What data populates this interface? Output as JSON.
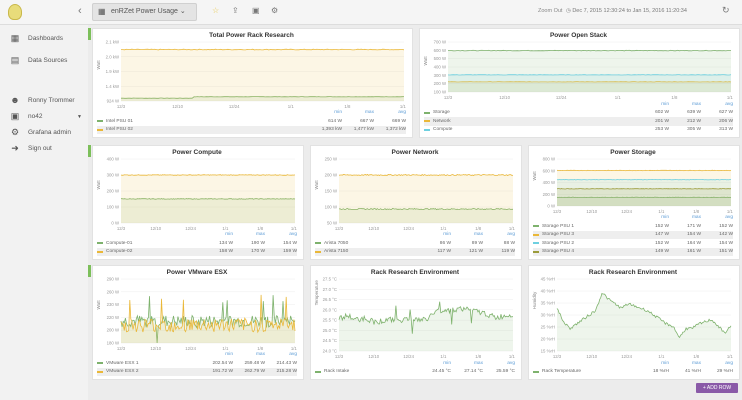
{
  "topbar": {
    "dashboard_title": "enRZet Power Usage",
    "zoom_out": "Zoom Out",
    "time_range": "Dec 7, 2015 12:30:24 to Jan 15, 2016 11:20:34",
    "icons": [
      "dashboard-grid-icon",
      "star-icon",
      "share-icon",
      "save-icon",
      "settings-icon",
      "clock-icon",
      "refresh-icon"
    ]
  },
  "sidebar": {
    "items": [
      {
        "label": "Dashboards",
        "icon": "grid-icon"
      },
      {
        "label": "Data Sources",
        "icon": "database-icon"
      }
    ],
    "user": {
      "name": "Ronny Trommer",
      "org": "no42",
      "admin": "Grafana admin",
      "signout": "Sign out"
    }
  },
  "colors": {
    "green": "#7eb26d",
    "yellow": "#eab839",
    "blue": "#6ed0e0",
    "olive": "#9b9b3a",
    "accent": "#7cbf5a",
    "add_row": "#8a5aa8"
  },
  "add_row": "+ ADD ROW",
  "legend_headers": [
    "min",
    "max",
    "avg"
  ],
  "x_ticks": [
    "12/3",
    "12/10",
    "12/24",
    "1/1",
    "1/8",
    "1/15"
  ],
  "panels": [
    {
      "title": "Total Power Rack Research",
      "ylabel": "Watt",
      "yticks": [
        "2.1 kW",
        "2.0 kW",
        "1.9 kW",
        "1.4 kW",
        "924 W"
      ],
      "ymin": 900,
      "ymax": 2150,
      "series": [
        {
          "name": "Intel PSU 01",
          "color": "#7eb26d",
          "level": 960,
          "step": 1000,
          "noise": 4,
          "stats": [
            "614 W",
            "667 W",
            "669 W"
          ]
        },
        {
          "name": "Intel PSU 02",
          "color": "#eab839",
          "level": 1990,
          "noise": 8,
          "stats": [
            "1,393 kW",
            "1,477 kW",
            "1,372 kW"
          ]
        }
      ]
    },
    {
      "title": "Power Open Stack",
      "ylabel": "Watt",
      "yticks": [
        "700 W",
        "600 W",
        "500 W",
        "400 W",
        "300 W",
        "200 W",
        "100 W"
      ],
      "ymin": 80,
      "ymax": 720,
      "series": [
        {
          "name": "Storage",
          "color": "#7eb26d",
          "level": 610,
          "noise": 4,
          "stats": [
            "602 W",
            "639 W",
            "627 W"
          ]
        },
        {
          "name": "Network",
          "color": "#eab839",
          "level": 210,
          "noise": 2,
          "stats": [
            "201 W",
            "212 W",
            "206 W"
          ]
        },
        {
          "name": "Compute",
          "color": "#6ed0e0",
          "level": 300,
          "noise": 3,
          "stats": [
            "253 W",
            "305 W",
            "313 W"
          ]
        }
      ]
    },
    {
      "title": "Power Compute",
      "ylabel": "Watt",
      "yticks": [
        "400 W",
        "300 W",
        "200 W",
        "100 W",
        "0 W"
      ],
      "ymin": 0,
      "ymax": 420,
      "series": [
        {
          "name": "Compute-01",
          "color": "#7eb26d",
          "level": 158,
          "noise": 2,
          "stats": [
            "134 W",
            "190 W",
            "154 W"
          ]
        },
        {
          "name": "Compute-02",
          "color": "#eab839",
          "level": 315,
          "noise": 2,
          "stats": [
            "158 W",
            "170 W",
            "159 W"
          ]
        }
      ]
    },
    {
      "title": "Power Network",
      "ylabel": "Watt",
      "yticks": [
        "250 W",
        "200 W",
        "150 W",
        "100 W",
        "50 W"
      ],
      "ymin": 40,
      "ymax": 260,
      "series": [
        {
          "name": "Arista 7050",
          "color": "#7eb26d",
          "level": 88,
          "noise": 2,
          "stats": [
            "86 W",
            "89 W",
            "88 W"
          ]
        },
        {
          "name": "Arista 7150",
          "color": "#eab839",
          "level": 205,
          "noise": 2,
          "stats": [
            "117 W",
            "121 W",
            "119 W"
          ]
        }
      ]
    },
    {
      "title": "Power Storage",
      "ylabel": "Watt",
      "yticks": [
        "800 W",
        "600 W",
        "400 W",
        "200 W",
        "0 W"
      ],
      "ymin": 0,
      "ymax": 820,
      "series": [
        {
          "name": "Storage PSU 1",
          "color": "#7eb26d",
          "level": 150,
          "noise": 4,
          "stats": [
            "152 W",
            "171 W",
            "152 W"
          ]
        },
        {
          "name": "Storage PSU 3",
          "color": "#eab839",
          "level": 620,
          "noise": 4,
          "stats": [
            "147 W",
            "154 W",
            "142 W"
          ]
        },
        {
          "name": "Storage PSU 2",
          "color": "#6ed0e0",
          "level": 460,
          "noise": 4,
          "stats": [
            "152 W",
            "164 W",
            "154 W"
          ]
        },
        {
          "name": "Storage PSU 4",
          "color": "#9b9b3a",
          "level": 300,
          "noise": 4,
          "stats": [
            "149 W",
            "161 W",
            "151 W"
          ]
        }
      ]
    },
    {
      "title": "Power VMware ESX",
      "ylabel": "Watt",
      "yticks": [
        "290 W",
        "260 W",
        "230 W",
        "220 W",
        "200 W",
        "180 W"
      ],
      "ymin": 170,
      "ymax": 295,
      "series": [
        {
          "name": "VMware ESX 1",
          "color": "#7eb26d",
          "level": 212,
          "noise": 12,
          "spikes": true,
          "stats": [
            "202.54 W",
            "259.48 W",
            "214.43 W"
          ]
        },
        {
          "name": "VMware ESX 2",
          "color": "#eab839",
          "level": 205,
          "noise": 14,
          "spikes": true,
          "stats": [
            "191.72 W",
            "262.79 W",
            "215.28 W"
          ]
        }
      ]
    },
    {
      "title": "Rack Research Environment",
      "ylabel": "Temperature",
      "yticks": [
        "27.5 °C",
        "27.0 °C",
        "26.5 °C",
        "26.0 °C",
        "25.5 °C",
        "25.0 °C",
        "24.5 °C",
        "24.0 °C"
      ],
      "ymin": 23.9,
      "ymax": 27.6,
      "series": [
        {
          "name": "Rack Intake",
          "color": "#7eb26d",
          "values": [
            25.6,
            25.7,
            25.5,
            25.6,
            25.4,
            25.45,
            25.5,
            25.5,
            25.55,
            25.5,
            25.5,
            25.9,
            26.0,
            26.0,
            26.1,
            26.0,
            25.9,
            25.8,
            25.6,
            25.7,
            25.8
          ],
          "noise": 0.15,
          "spikes": true,
          "stats": [
            "24.45 °C",
            "27.14 °C",
            "25.59 °C"
          ]
        }
      ]
    },
    {
      "title": "Rack Research Environment",
      "ylabel": "Humidity",
      "yticks": [
        "45 %rH",
        "40 %rH",
        "35 %rH",
        "30 %rH",
        "25 %rH",
        "20 %rH",
        "15 %rH"
      ],
      "ymin": 14,
      "ymax": 46,
      "series": [
        {
          "name": "Rack Temperature",
          "color": "#7eb26d",
          "values": [
            33,
            27,
            24,
            26,
            28,
            30,
            32,
            40,
            37,
            35,
            33,
            35,
            34,
            33,
            32,
            30,
            28,
            26,
            25,
            20,
            24,
            24,
            26,
            27,
            28,
            25,
            22,
            25
          ],
          "noise": 0.6,
          "stats": [
            "18 %rH",
            "41 %rH",
            "29 %rH"
          ]
        }
      ]
    }
  ]
}
